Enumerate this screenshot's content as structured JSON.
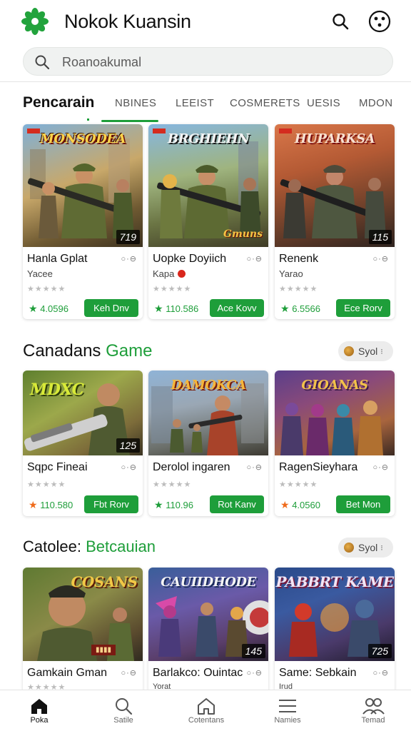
{
  "app": {
    "title": "Nokok Kuansin"
  },
  "search": {
    "placeholder": "Roanoakumal"
  },
  "tabs": {
    "title": "Pencarain",
    "items": [
      "NBINES",
      "LEEIST",
      "COSMERETS",
      "UESIS",
      "MDON"
    ],
    "active_index": 0
  },
  "sections": [
    {
      "title": "",
      "cards": [
        {
          "art_title": "MONSODEA",
          "badge": "719",
          "name": "Hanla Gplat",
          "sub": "Yacee",
          "price": "4.0596",
          "button": "Keh Dnv",
          "art": "a"
        },
        {
          "art_title": "BRGHIEHN",
          "badge": "",
          "name": "Uopke Doyiich",
          "sub": "Kapa",
          "price": "110.586",
          "button": "Ace Kovv",
          "art": "b"
        },
        {
          "art_title": "HUPARKSA",
          "badge": "115",
          "name": "Renenk",
          "sub": "Yarao",
          "price": "6.5566",
          "button": "Ece Rorv",
          "art": "c"
        }
      ]
    },
    {
      "title": "Canadans",
      "accent": "Game",
      "sort_label": "Syol",
      "cards": [
        {
          "art_title": "MDXC",
          "badge": "125",
          "name": "Sqpc Fineai",
          "price": "110.580",
          "button": "Fbt Rorv",
          "art": "d"
        },
        {
          "art_title": "DAMOKCA",
          "badge": "",
          "name": "Derolol ingaren",
          "price": "110.96",
          "button": "Rot Kanv",
          "art": "e"
        },
        {
          "art_title": "GIOANAS",
          "badge": "",
          "name": "RagenSieyhara",
          "price": "4.0560",
          "button": "Bet Mon",
          "art": "f"
        }
      ]
    },
    {
      "title": "Catolee:",
      "accent": "Betcauian",
      "sort_label": "Syol",
      "cards": [
        {
          "art_title": "COSANS",
          "badge": "",
          "name": "Gamkain Gman",
          "sub": "",
          "art": "g"
        },
        {
          "art_title": "CAUIIDHODE",
          "badge": "145",
          "name": "Barlakco: Ouintac",
          "sub": "Yorat",
          "art": "h"
        },
        {
          "art_title": "PABBRT KAME",
          "badge": "725",
          "name": "Same: Sebkain",
          "sub": "Irud",
          "art": "i"
        }
      ]
    }
  ],
  "option_glyph": "○·⊖",
  "stars_glyph": "★★★★★",
  "nav": [
    {
      "label": "Poka",
      "icon": "home-icon"
    },
    {
      "label": "Satile",
      "icon": "search-icon"
    },
    {
      "label": "Cotentans",
      "icon": "house-outline-icon"
    },
    {
      "label": "Namies",
      "icon": "menu-icon"
    },
    {
      "label": "Temad",
      "icon": "people-icon"
    }
  ],
  "colors": {
    "accent": "#1e9e3a",
    "button": "#1e9e3a"
  }
}
